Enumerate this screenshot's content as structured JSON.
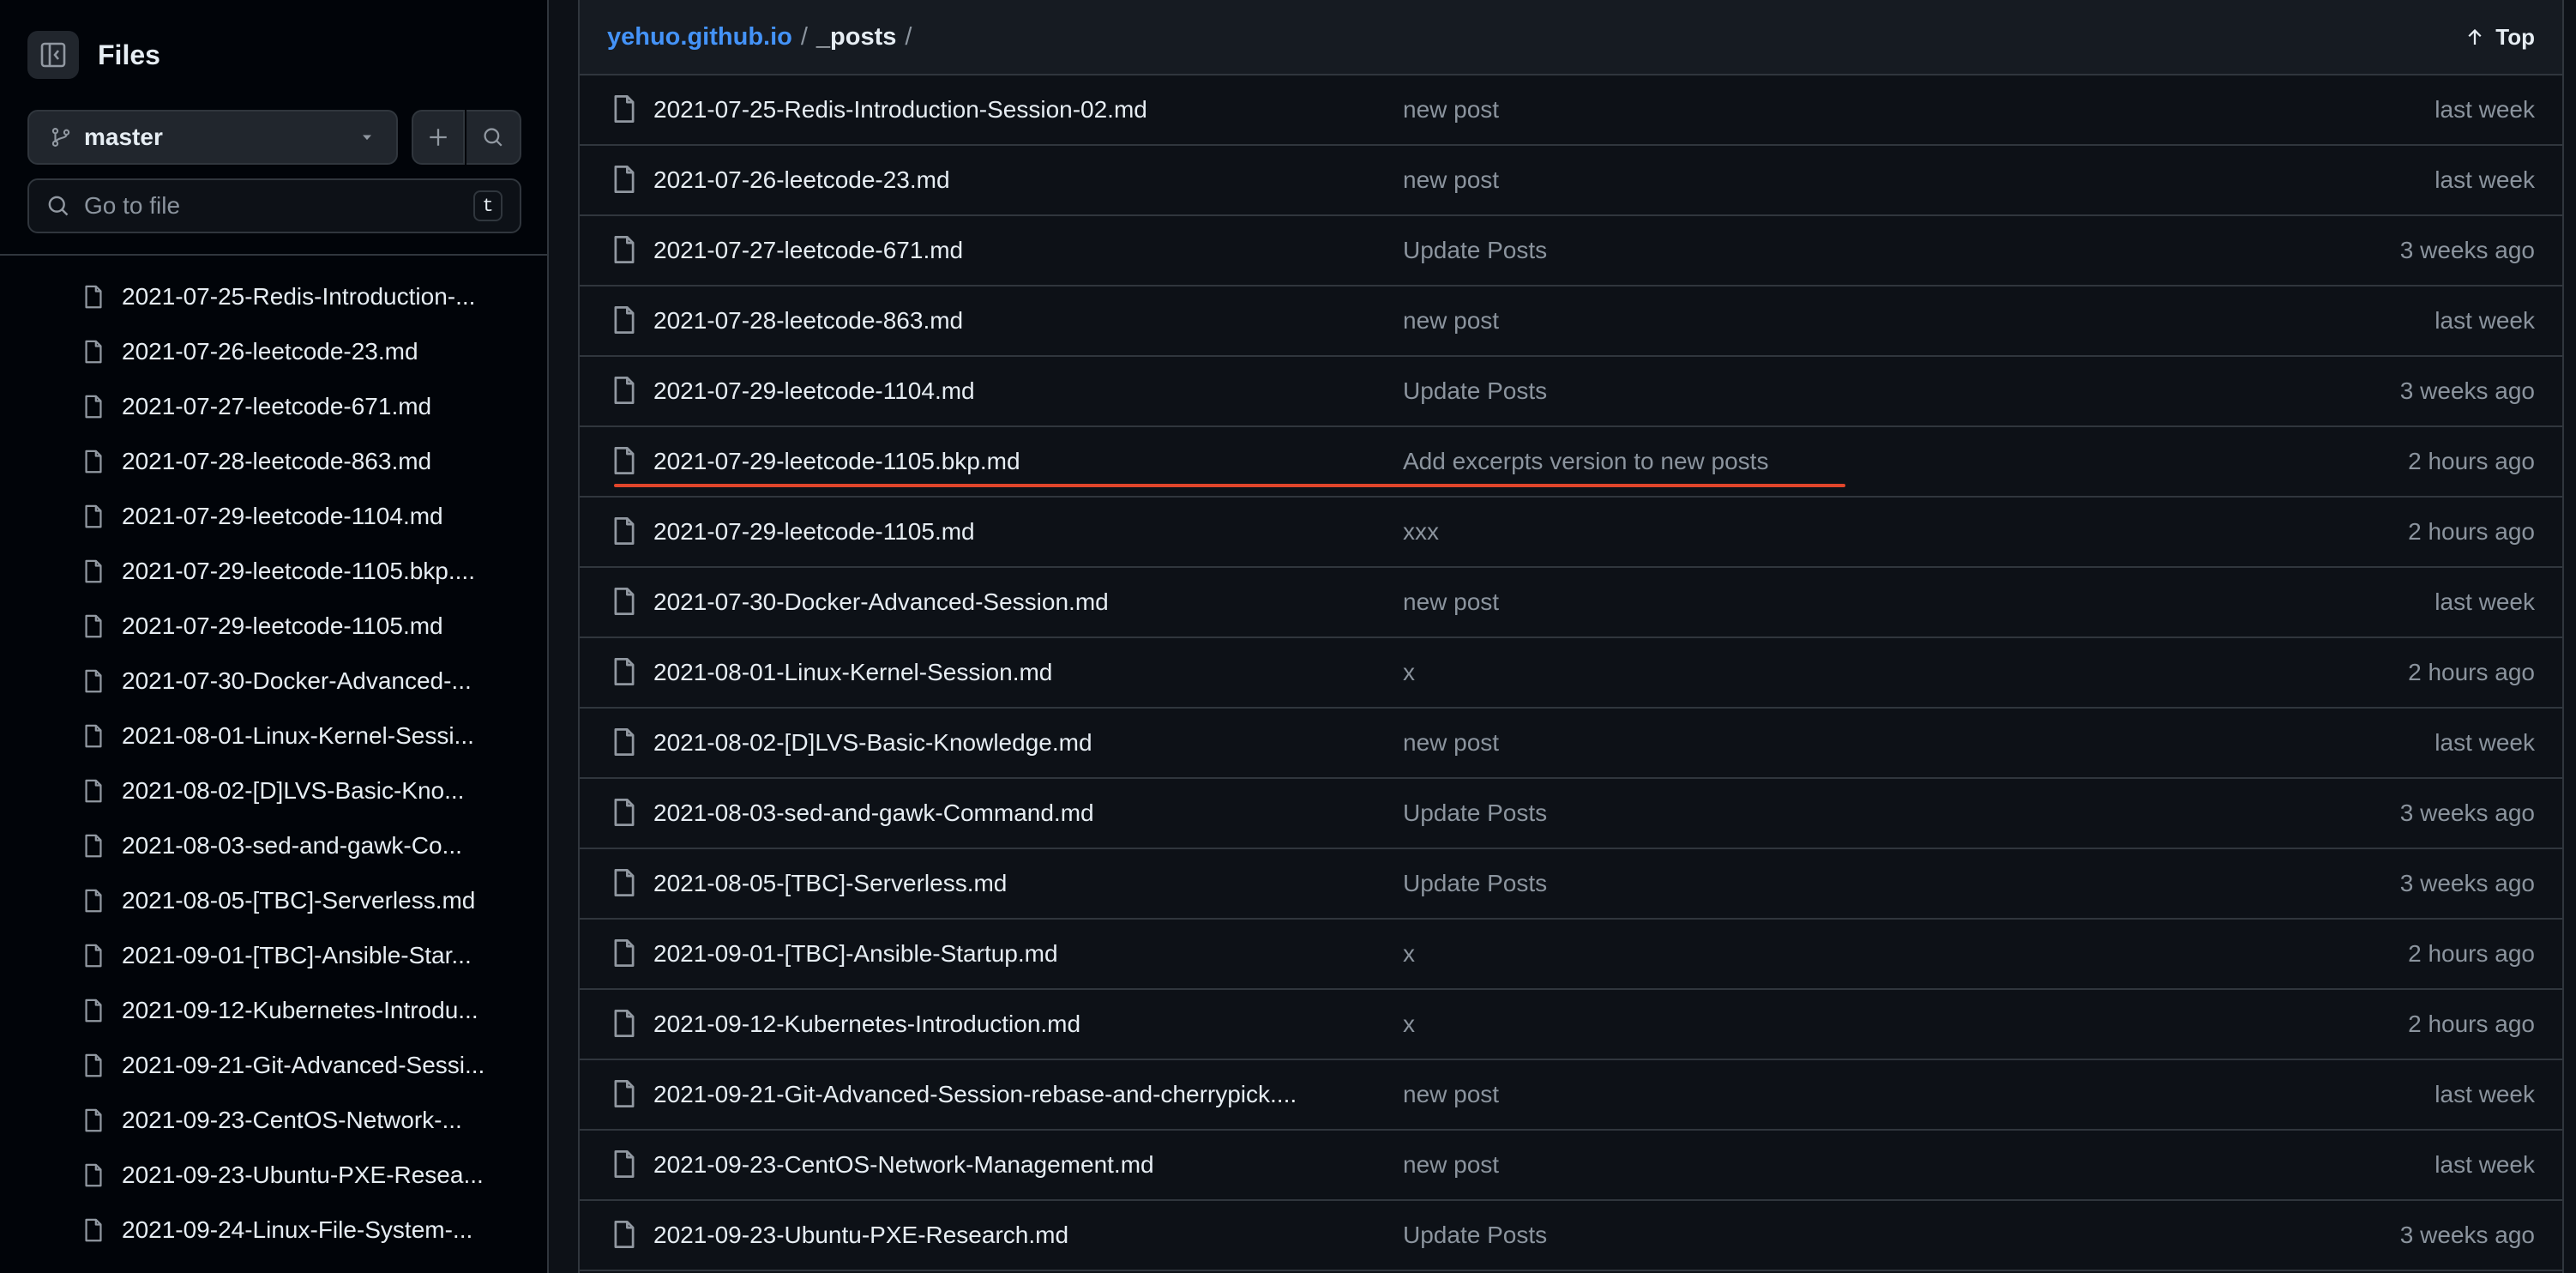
{
  "sidebar": {
    "title": "Files",
    "branch": "master",
    "goto_placeholder": "Go to file",
    "goto_shortcut": "t",
    "items": [
      "2021-07-25-Redis-Introduction-...",
      "2021-07-26-leetcode-23.md",
      "2021-07-27-leetcode-671.md",
      "2021-07-28-leetcode-863.md",
      "2021-07-29-leetcode-1104.md",
      "2021-07-29-leetcode-1105.bkp....",
      "2021-07-29-leetcode-1105.md",
      "2021-07-30-Docker-Advanced-...",
      "2021-08-01-Linux-Kernel-Sessi...",
      "2021-08-02-[D]LVS-Basic-Kno...",
      "2021-08-03-sed-and-gawk-Co...",
      "2021-08-05-[TBC]-Serverless.md",
      "2021-09-01-[TBC]-Ansible-Star...",
      "2021-09-12-Kubernetes-Introdu...",
      "2021-09-21-Git-Advanced-Sessi...",
      "2021-09-23-CentOS-Network-...",
      "2021-09-23-Ubuntu-PXE-Resea...",
      "2021-09-24-Linux-File-System-..."
    ]
  },
  "header": {
    "repo": "yehuo.github.io",
    "separator": "/",
    "dir": "_posts",
    "trailing": "/",
    "top_label": "Top"
  },
  "files": [
    {
      "name": "2021-07-25-Redis-Introduction-Session-02.md",
      "message": "new post",
      "age": "last week"
    },
    {
      "name": "2021-07-26-leetcode-23.md",
      "message": "new post",
      "age": "last week"
    },
    {
      "name": "2021-07-27-leetcode-671.md",
      "message": "Update Posts",
      "age": "3 weeks ago"
    },
    {
      "name": "2021-07-28-leetcode-863.md",
      "message": "new post",
      "age": "last week"
    },
    {
      "name": "2021-07-29-leetcode-1104.md",
      "message": "Update Posts",
      "age": "3 weeks ago"
    },
    {
      "name": "2021-07-29-leetcode-1105.bkp.md",
      "message": "Add excerpts version to new posts",
      "age": "2 hours ago"
    },
    {
      "name": "2021-07-29-leetcode-1105.md",
      "message": "xxx",
      "age": "2 hours ago"
    },
    {
      "name": "2021-07-30-Docker-Advanced-Session.md",
      "message": "new post",
      "age": "last week"
    },
    {
      "name": "2021-08-01-Linux-Kernel-Session.md",
      "message": "x",
      "age": "2 hours ago"
    },
    {
      "name": "2021-08-02-[D]LVS-Basic-Knowledge.md",
      "message": "new post",
      "age": "last week"
    },
    {
      "name": "2021-08-03-sed-and-gawk-Command.md",
      "message": "Update Posts",
      "age": "3 weeks ago"
    },
    {
      "name": "2021-08-05-[TBC]-Serverless.md",
      "message": "Update Posts",
      "age": "3 weeks ago"
    },
    {
      "name": "2021-09-01-[TBC]-Ansible-Startup.md",
      "message": "x",
      "age": "2 hours ago"
    },
    {
      "name": "2021-09-12-Kubernetes-Introduction.md",
      "message": "x",
      "age": "2 hours ago"
    },
    {
      "name": "2021-09-21-Git-Advanced-Session-rebase-and-cherrypick....",
      "message": "new post",
      "age": "last week"
    },
    {
      "name": "2021-09-23-CentOS-Network-Management.md",
      "message": "new post",
      "age": "last week"
    },
    {
      "name": "2021-09-23-Ubuntu-PXE-Research.md",
      "message": "Update Posts",
      "age": "3 weeks ago"
    }
  ],
  "colors": {
    "background": "#0d1117",
    "sidebar": "#010409",
    "link": "#4493f8",
    "highlight_underline": "#e0452b"
  },
  "icons": [
    "sidebar-collapse-icon",
    "git-branch-icon",
    "triangle-down-icon",
    "plus-icon",
    "search-icon",
    "file-icon",
    "arrow-up-icon"
  ]
}
